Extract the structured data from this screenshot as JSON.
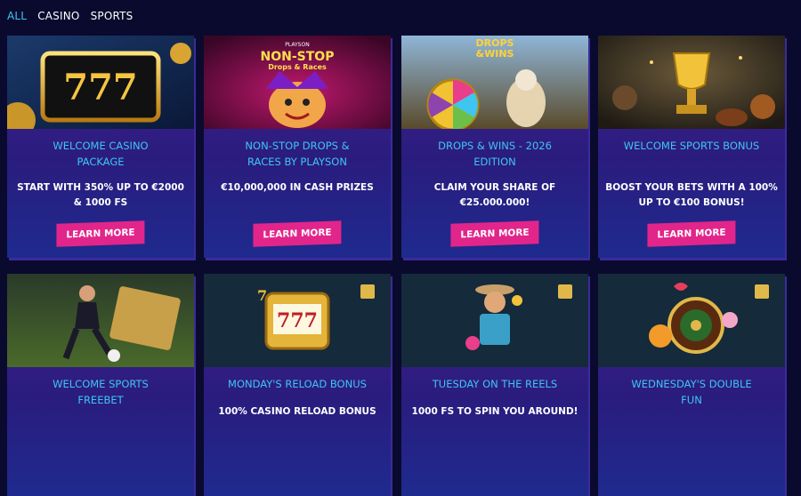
{
  "tabs": [
    {
      "label": "ALL",
      "active": true
    },
    {
      "label": "CASINO",
      "active": false
    },
    {
      "label": "SPORTS",
      "active": false
    }
  ],
  "cards": [
    {
      "title": "WELCOME CASINO\nPACKAGE",
      "description": "START WITH 350% UP TO €2000\n& 1000 FS",
      "button": "LEARN MORE",
      "art": {
        "badge_text": "777"
      }
    },
    {
      "title": "NON-STOP DROPS &\nRACES BY PLAYSON",
      "description": "€10,000,000 IN CASH PRIZES",
      "button": "LEARN MORE",
      "art": {
        "brand": "PLAYSON",
        "headline": "NON-STOP",
        "subline": "Drops & Races"
      }
    },
    {
      "title": "DROPS & WINS - 2026\nEDITION",
      "description": "CLAIM YOUR SHARE OF\n€25.000.000!",
      "button": "LEARN MORE",
      "art": {
        "line1": "DROPS",
        "line2": "&WINS"
      }
    },
    {
      "title": "WELCOME SPORTS BONUS",
      "description": "BOOST YOUR BETS WITH A 100%\nUP TO €100 BONUS!",
      "button": "LEARN MORE",
      "art": {}
    },
    {
      "title": "WELCOME SPORTS\nFREEBET",
      "description": "",
      "button": "",
      "art": {}
    },
    {
      "title": "MONDAY'S RELOAD BONUS",
      "description": "100% CASINO RELOAD BONUS",
      "button": "",
      "art": {
        "badge_text": "777"
      }
    },
    {
      "title": "TUESDAY ON THE REELS",
      "description": "1000 FS TO SPIN YOU AROUND!",
      "button": "",
      "art": {}
    },
    {
      "title": "WEDNESDAY'S DOUBLE\nFUN",
      "description": "",
      "button": "",
      "art": {}
    }
  ]
}
